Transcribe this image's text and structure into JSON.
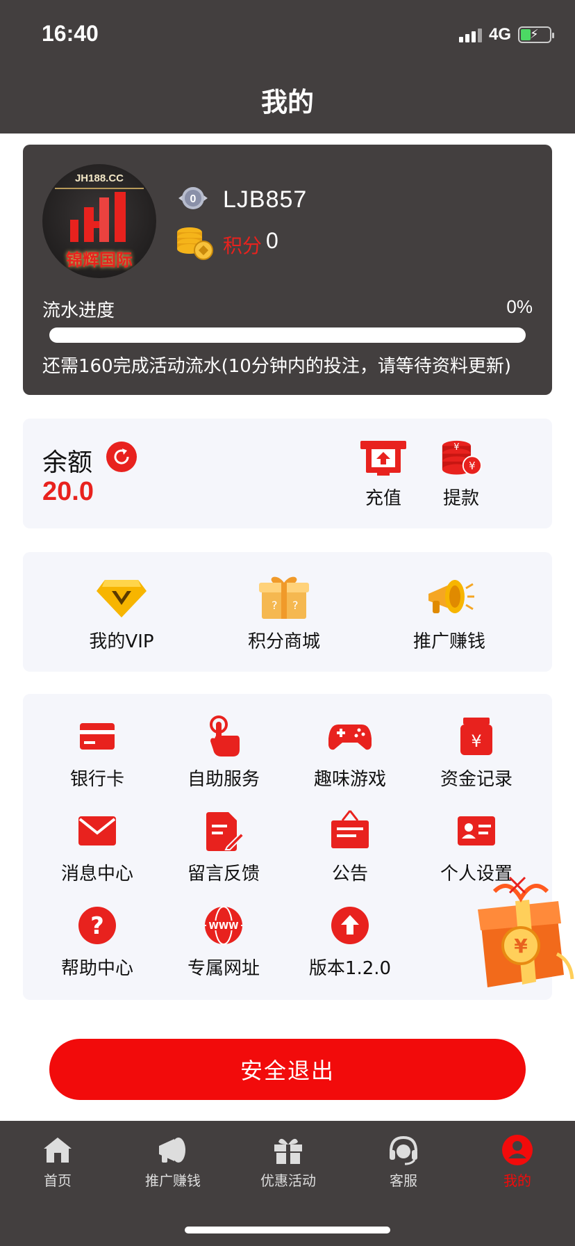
{
  "status_bar": {
    "time": "16:40",
    "network": "4G"
  },
  "header": {
    "title": "我的"
  },
  "profile": {
    "avatar_text_top": "JH188.CC",
    "avatar_text_bottom": "锦辉国际",
    "level": "0",
    "username": "LJB857",
    "points_label": "积分",
    "points_value": "0",
    "progress_label": "流水进度",
    "progress_percent_text": "0%",
    "progress_fraction": 0,
    "progress_note": "还需160完成活动流水(10分钟内的投注，请等待资料更新)"
  },
  "balance": {
    "label": "余额",
    "value": "20.0",
    "deposit_label": "充值",
    "withdraw_label": "提款"
  },
  "features": [
    {
      "label": "我的VIP",
      "icon": "vip-diamond-icon"
    },
    {
      "label": "积分商城",
      "icon": "gift-box-icon"
    },
    {
      "label": "推广赚钱",
      "icon": "megaphone-icon"
    }
  ],
  "grid": [
    {
      "label": "银行卡",
      "icon": "bank-card-icon"
    },
    {
      "label": "自助服务",
      "icon": "tap-hand-icon"
    },
    {
      "label": "趣味游戏",
      "icon": "gamepad-icon"
    },
    {
      "label": "资金记录",
      "icon": "money-record-icon"
    },
    {
      "label": "消息中心",
      "icon": "mail-icon"
    },
    {
      "label": "留言反馈",
      "icon": "feedback-icon"
    },
    {
      "label": "公告",
      "icon": "notice-board-icon"
    },
    {
      "label": "个人设置",
      "icon": "id-card-icon"
    },
    {
      "label": "帮助中心",
      "icon": "help-icon"
    },
    {
      "label": "专属网址",
      "icon": "www-globe-icon"
    },
    {
      "label": "版本1.2.0",
      "icon": "upload-arrow-icon"
    }
  ],
  "logout": {
    "label": "安全退出"
  },
  "tabbar": [
    {
      "label": "首页",
      "icon": "home-icon"
    },
    {
      "label": "推广赚钱",
      "icon": "megaphone-icon"
    },
    {
      "label": "优惠活动",
      "icon": "gift-icon"
    },
    {
      "label": "客服",
      "icon": "headset-icon"
    },
    {
      "label": "我的",
      "icon": "user-icon",
      "active": true
    }
  ],
  "colors": {
    "header_bg": "#433f3f",
    "accent_red": "#f20b0b",
    "card_bg": "#f5f6fb"
  }
}
